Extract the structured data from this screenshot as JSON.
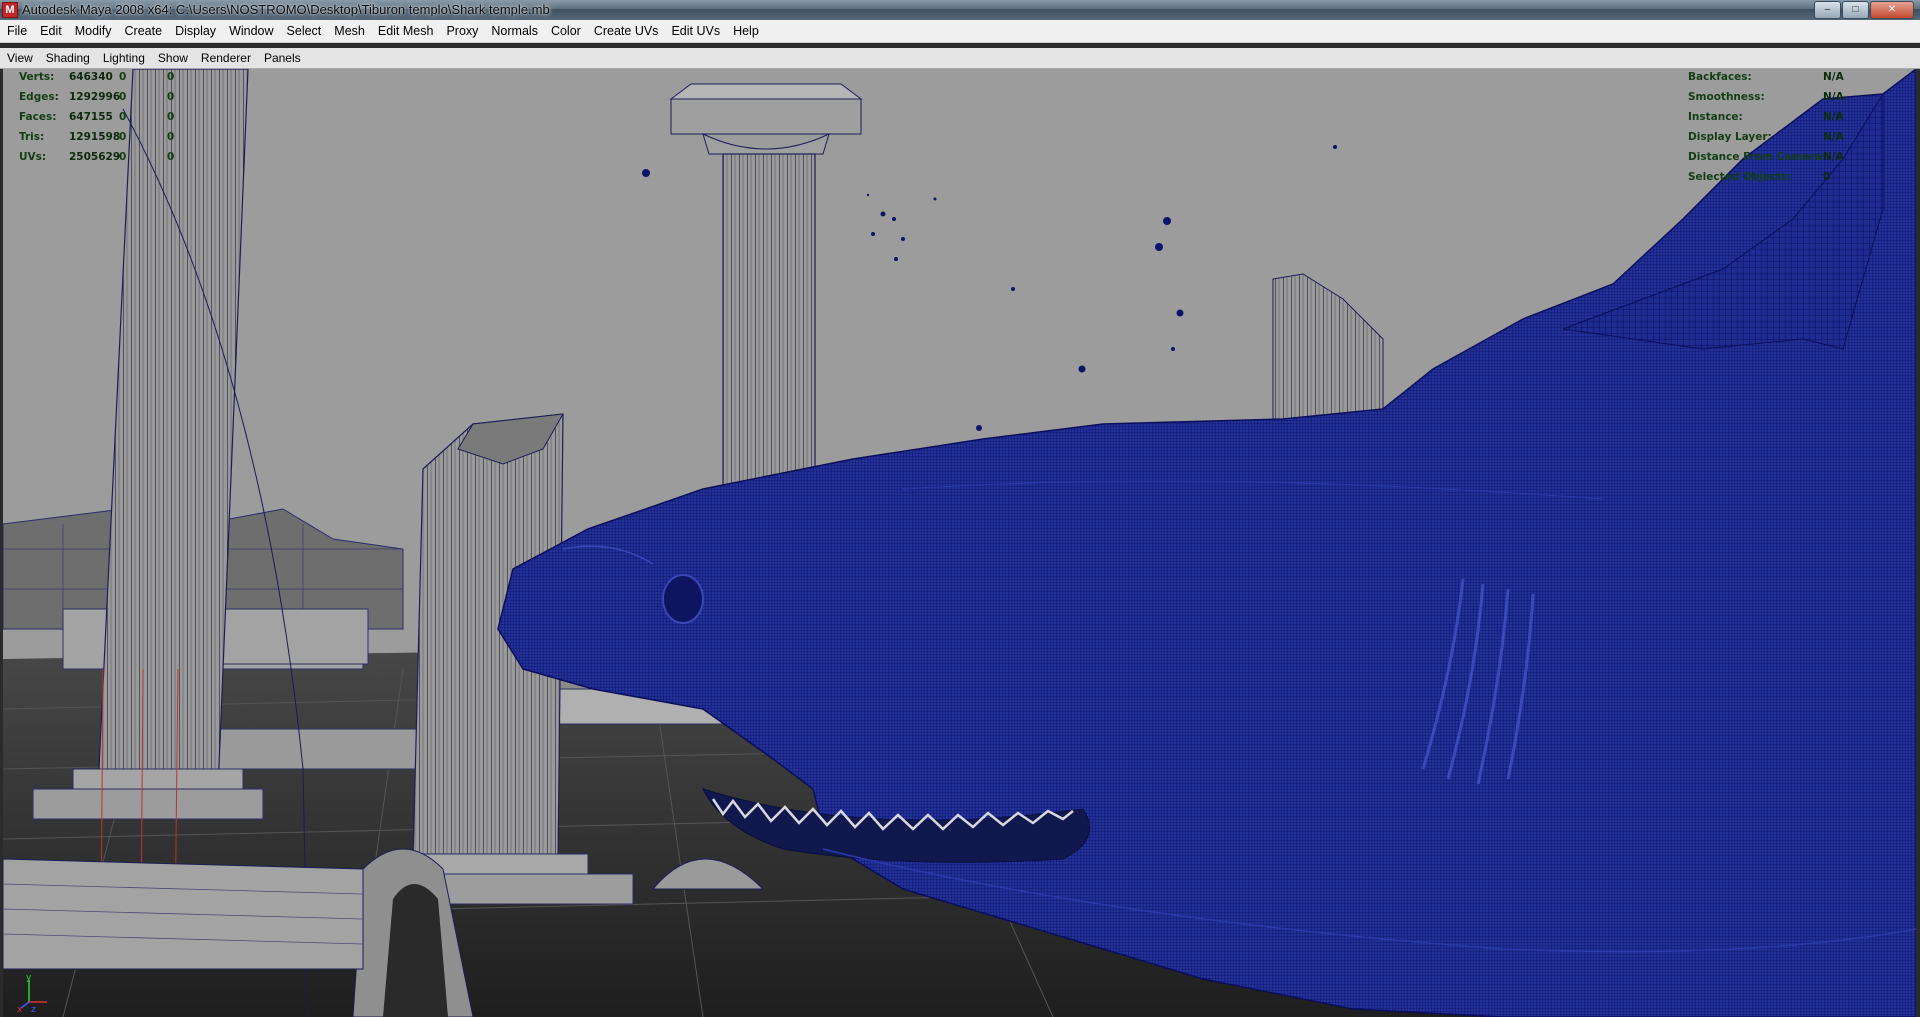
{
  "window": {
    "title": "Autodesk Maya 2008 x64: C:\\Users\\NOSTROMO\\Desktop\\Tiburon templo\\Shark temple.mb",
    "buttons": [
      "minimize",
      "maximize",
      "close"
    ]
  },
  "menubar": {
    "items": [
      "File",
      "Edit",
      "Modify",
      "Create",
      "Display",
      "Window",
      "Select",
      "Mesh",
      "Edit Mesh",
      "Proxy",
      "Normals",
      "Color",
      "Create UVs",
      "Edit UVs",
      "Help"
    ]
  },
  "panel_menu": {
    "items": [
      "View",
      "Shading",
      "Lighting",
      "Show",
      "Renderer",
      "Panels"
    ]
  },
  "hud_left": [
    {
      "label": "Verts:",
      "value": "646340",
      "selected": "0",
      "extra": "0"
    },
    {
      "label": "Edges:",
      "value": "1292996",
      "selected": "0",
      "extra": "0"
    },
    {
      "label": "Faces:",
      "value": "647155",
      "selected": "0",
      "extra": "0"
    },
    {
      "label": "Tris:",
      "value": "1291598",
      "selected": "0",
      "extra": "0"
    },
    {
      "label": "UVs:",
      "value": "2505629",
      "selected": "0",
      "extra": "0"
    }
  ],
  "hud_right": [
    {
      "label": "Backfaces:",
      "value": "N/A"
    },
    {
      "label": "Smoothness:",
      "value": "N/A"
    },
    {
      "label": "Instance:",
      "value": "N/A"
    },
    {
      "label": "Display Layer:",
      "value": "N/A"
    },
    {
      "label": "Distance From Camera:",
      "value": "N/A"
    },
    {
      "label": "Selected Objects:",
      "value": "0"
    }
  ],
  "axis": {
    "x": "x",
    "y": "y",
    "z": "z"
  },
  "colors": {
    "viewport_bg": "#9c9c9c",
    "wireframe": "#0a0f6e",
    "mesh_fill": "#1a2a8c",
    "hud_text": "#123e12",
    "menubar_bg": "#f0f0f0"
  }
}
